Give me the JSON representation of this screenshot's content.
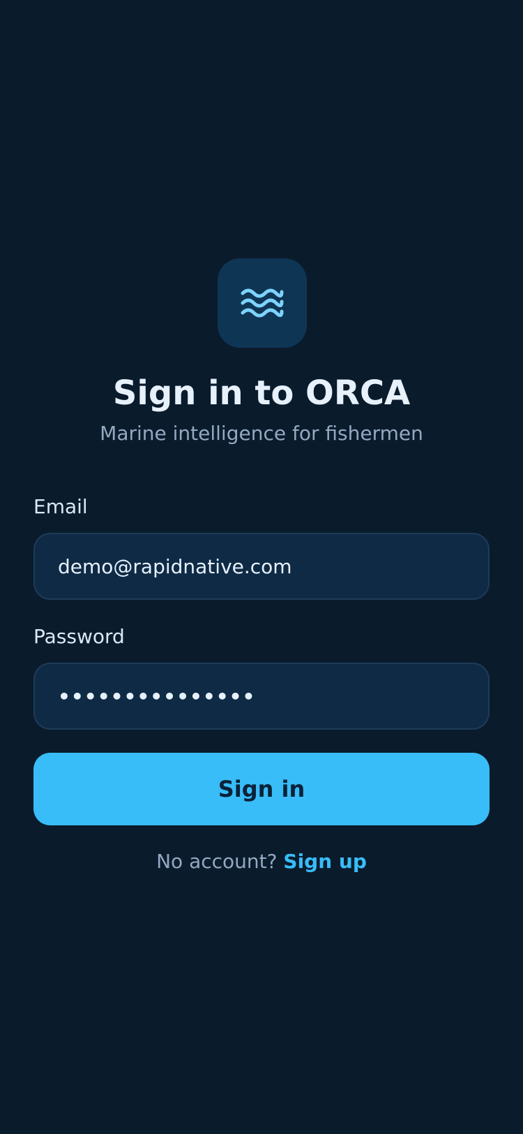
{
  "app": {
    "logo_icon": "waves-icon",
    "title": "Sign in to ORCA",
    "subtitle": "Marine intelligence for fishermen"
  },
  "form": {
    "email_label": "Email",
    "email_value": "demo@rapidnative.com",
    "password_label": "Password",
    "password_value": "•••••••••••••••",
    "submit_label": "Sign in"
  },
  "footer": {
    "prompt": "No account?",
    "link_label": "Sign up"
  },
  "colors": {
    "background": "#0a1b2c",
    "accent": "#38bdf8",
    "field_background": "#0f2a45",
    "logo_background": "#0f3555"
  }
}
